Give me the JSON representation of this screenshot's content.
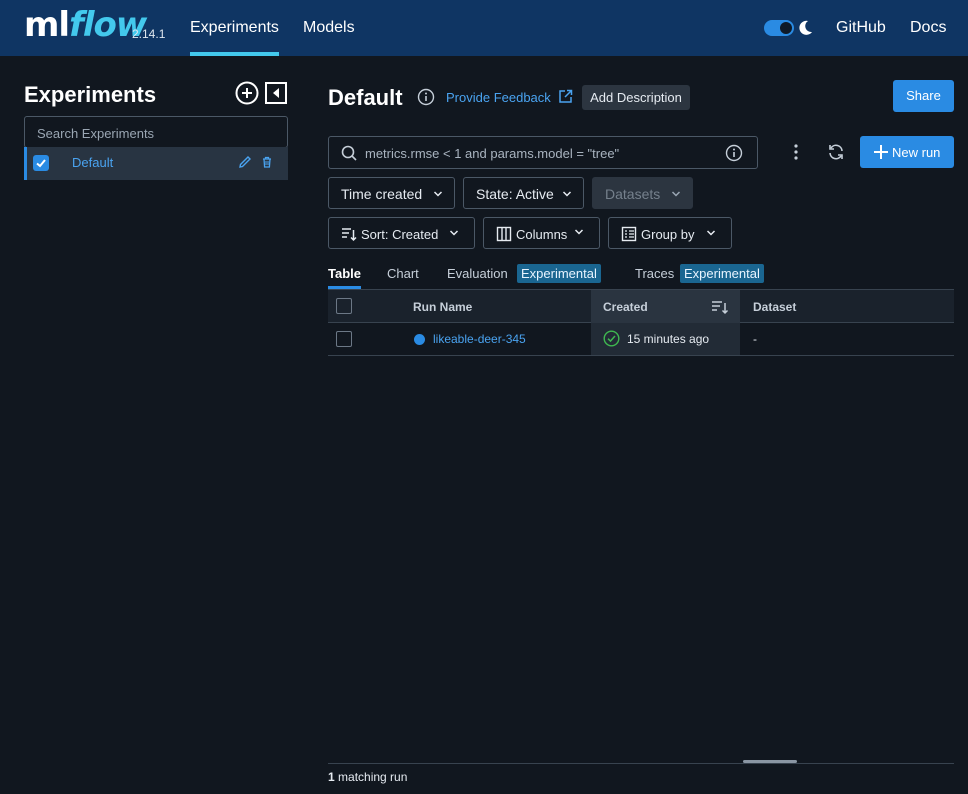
{
  "app": {
    "logo_ml": "ml",
    "logo_flow": "flow",
    "version": "2.14.1"
  },
  "nav": {
    "experiments": "Experiments",
    "models": "Models",
    "github": "GitHub",
    "docs": "Docs",
    "theme_toggle_on": true
  },
  "sidebar": {
    "title": "Experiments",
    "search_placeholder": "Search Experiments",
    "items": [
      {
        "label": "Default",
        "checked": true
      }
    ]
  },
  "header": {
    "title": "Default",
    "feedback": "Provide Feedback",
    "add_description": "Add Description",
    "share": "Share"
  },
  "search": {
    "placeholder": "metrics.rmse < 1 and params.model = \"tree\"",
    "new_run": "New run"
  },
  "filters": {
    "time_created": "Time created",
    "state": "State: Active",
    "datasets": "Datasets",
    "sort": "Sort: Created",
    "columns": "Columns",
    "group_by": "Group by"
  },
  "tabs": [
    {
      "label": "Table",
      "active": true
    },
    {
      "label": "Chart"
    },
    {
      "label": "Evaluation",
      "tag": "Experimental"
    },
    {
      "label": "Traces",
      "tag": "Experimental"
    }
  ],
  "table": {
    "columns": [
      "Run Name",
      "Created",
      "Dataset"
    ],
    "rows": [
      {
        "run_name": "likeable-deer-345",
        "created": "15 minutes ago",
        "dataset": "-"
      }
    ]
  },
  "footer": {
    "count": "1",
    "suffix": "matching run"
  },
  "colors": {
    "topbar": "#0f3563",
    "accent": "#2a8be3",
    "logo_flow": "#43c9ed",
    "tag": "#1a6691",
    "success": "#3fb950"
  }
}
